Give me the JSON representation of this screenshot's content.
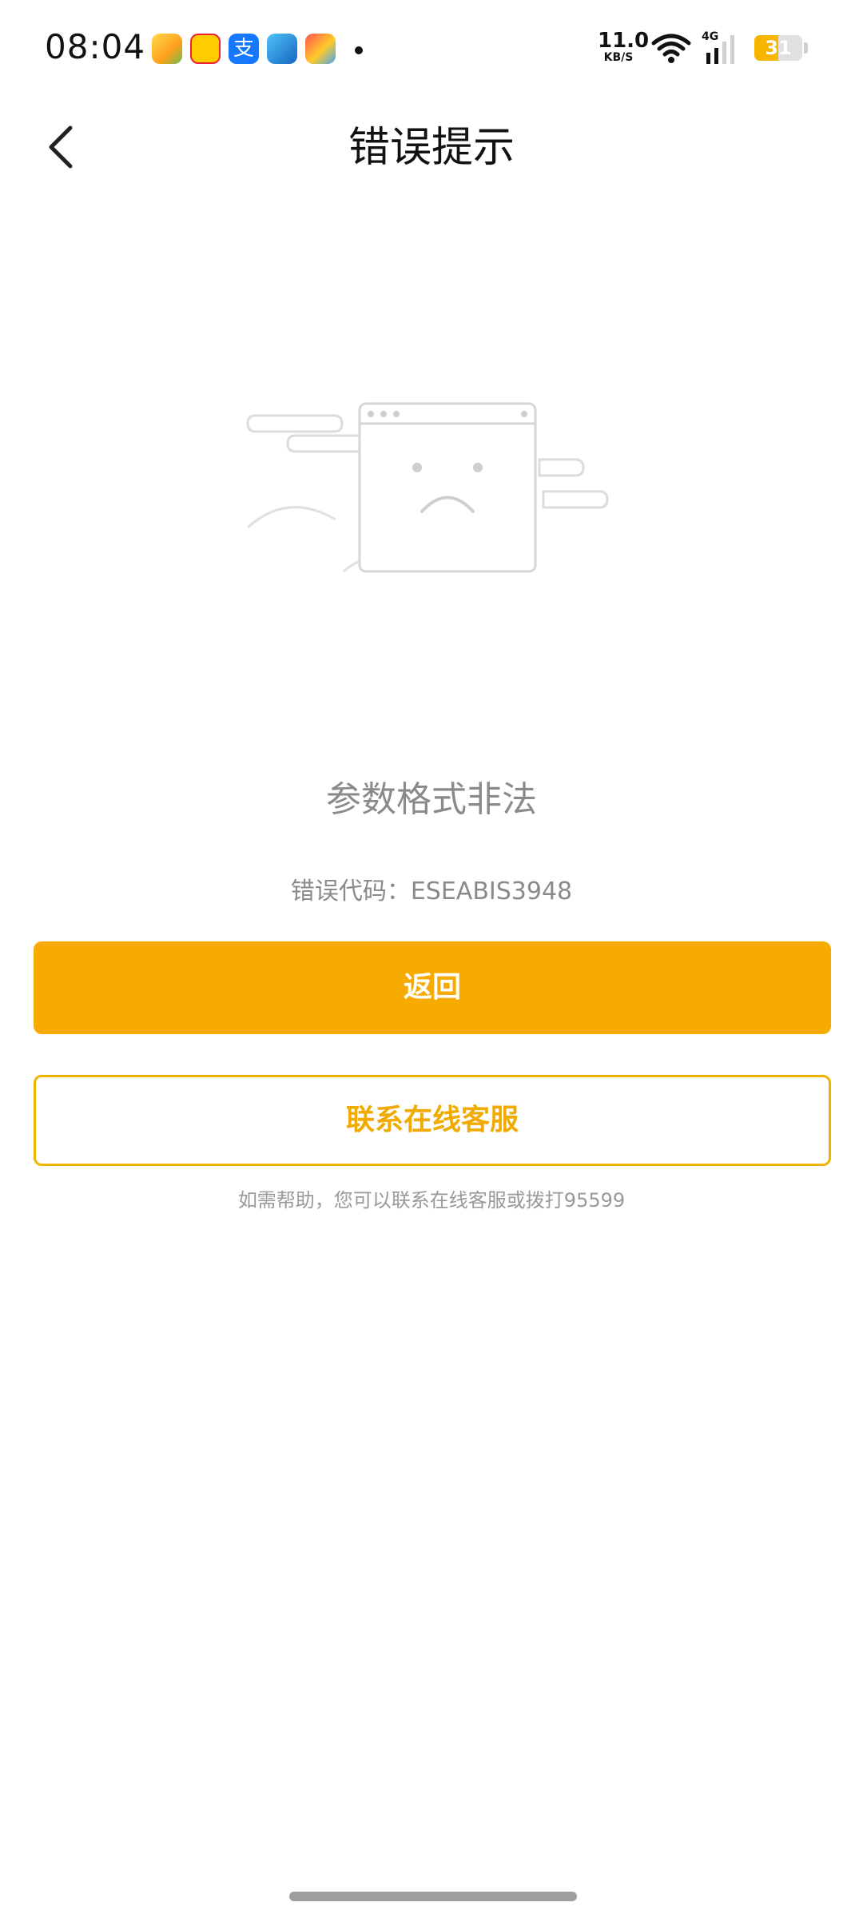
{
  "status_bar": {
    "time": "08:04",
    "net_speed_value": "11.0",
    "net_speed_unit": "KB/S",
    "network_type": "4G",
    "battery_level": "31",
    "battery_fraction": 0.31,
    "notification_icons": [
      "photos-app-icon",
      "shopping-app-icon",
      "alipay-icon",
      "telegram-icon",
      "game-app-icon"
    ],
    "alipay_glyph": "支"
  },
  "nav": {
    "title": "错误提示",
    "back_icon": "chevron-left-icon"
  },
  "error": {
    "message": "参数格式非法",
    "code_label": "错误代码：",
    "code_value": "ESEABIS3948"
  },
  "actions": {
    "back_label": "返回",
    "contact_label": "联系在线客服"
  },
  "help_text": "如需帮助，您可以联系在线客服或拨打95599",
  "colors": {
    "accent": "#f7ab00",
    "outline": "#f0b400",
    "muted_text": "#8a8a8a"
  }
}
